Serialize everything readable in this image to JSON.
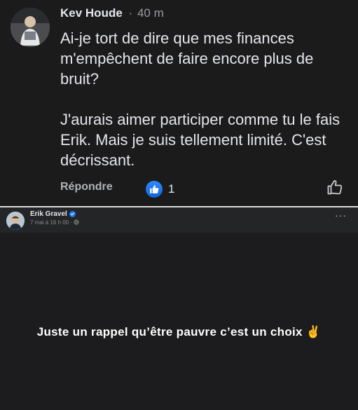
{
  "comment": {
    "author": "Kev Houde",
    "separator": "·",
    "time": "40 m",
    "paragraphs": [
      "Ai-je tort de dire que mes finances m'empêchent de faire encore plus de bruit?",
      "J'aurais aimer participer comme tu le fais Erik. Mais je suis tellement limité. C'est décrissant."
    ],
    "reply_label": "Répondre",
    "reaction_count": "1",
    "reaction_icon": "thumbs-up-icon",
    "like_color": "#2e89ff"
  },
  "post": {
    "author": "Erik Gravel",
    "meta": "7 mai à 16 h 00 · ",
    "more_label": "···",
    "text": "Juste un rappel qu’être pauvre c’est un choix ✌️"
  }
}
